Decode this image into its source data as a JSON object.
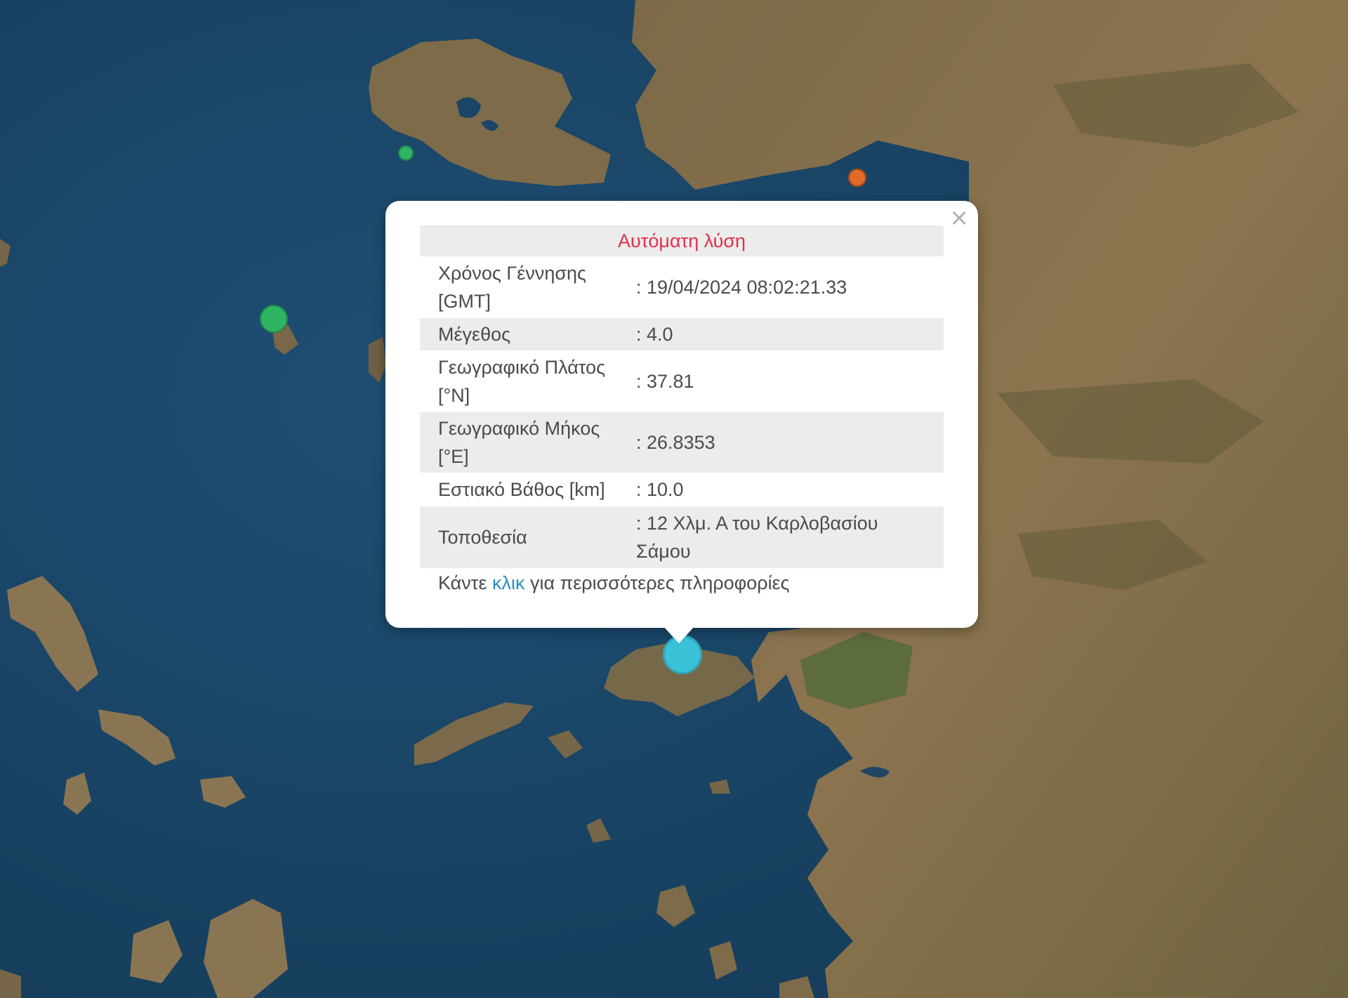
{
  "popup": {
    "header": "Αυτόματη λύση",
    "close_symbol": "×",
    "rows": [
      {
        "label_line1": "Χρόνος Γέννησης",
        "label_line2": "[GMT]",
        "value": ": 19/04/2024 08:02:21.33"
      },
      {
        "label_line1": "Μέγεθος",
        "label_line2": "",
        "value": ": 4.0"
      },
      {
        "label_line1": "Γεωγραφικό Πλάτος",
        "label_line2": "[°N]",
        "value": ": 37.81"
      },
      {
        "label_line1": "Γεωγραφικό Μήκος",
        "label_line2": "[°E]",
        "value": ": 26.8353"
      },
      {
        "label_line1": "Εστιακό Βάθος [km]",
        "label_line2": "",
        "value": ": 10.0"
      },
      {
        "label_line1": "Τοποθεσία",
        "label_line2": "",
        "value": ": 12 Χλμ. Α του Καρλοβασίου",
        "value_line2": "Σάμου"
      }
    ],
    "more_prefix": "Κάντε ",
    "more_link": "κλικ",
    "more_suffix": " για περισσότερες πληροφορίες"
  },
  "markers": [
    {
      "name": "earthquake-marker-selected",
      "color": "#3bc2d9"
    },
    {
      "name": "earthquake-marker-green-large",
      "color": "#2fb463"
    },
    {
      "name": "earthquake-marker-green-small",
      "color": "#2fb463"
    },
    {
      "name": "earthquake-marker-orange",
      "color": "#e26a2c"
    }
  ],
  "colors": {
    "sea": "#1b4566",
    "land": "#8a7250",
    "header_text": "#e3304d",
    "link": "#2a8fc4"
  }
}
